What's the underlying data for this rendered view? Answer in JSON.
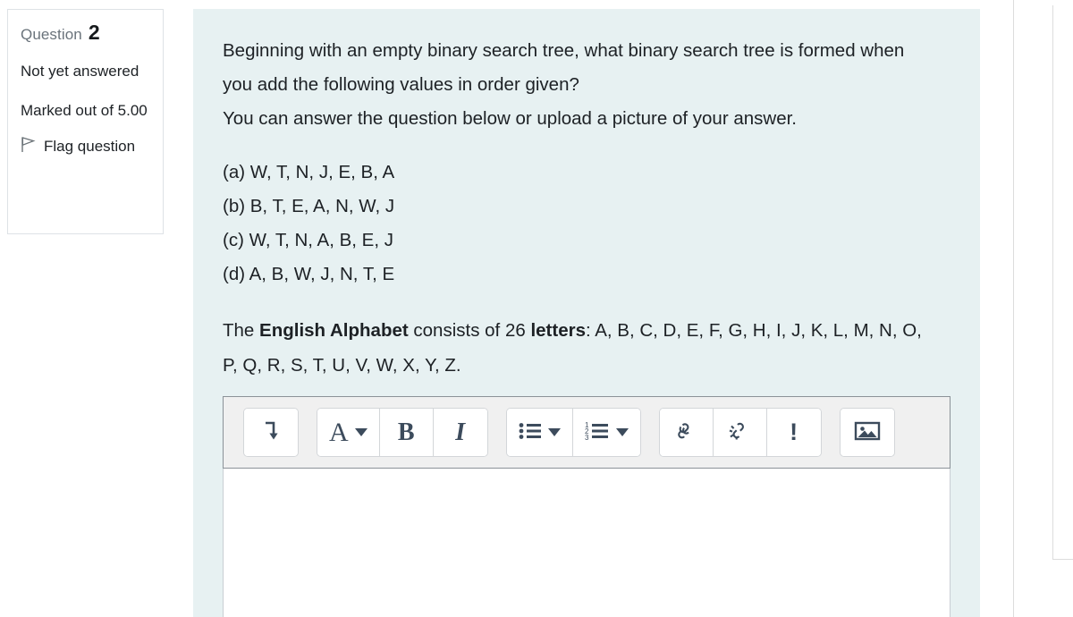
{
  "question_panel": {
    "question_label": "Question",
    "question_number": "2",
    "state": "Not yet answered",
    "marks": "Marked out of 5.00",
    "flag_label": "Flag question",
    "flag_icon": "flag-outline-icon"
  },
  "question": {
    "paragraphs": [
      "Beginning with an empty binary search tree, what binary search tree is formed when you add the following values in order given?",
      "You can answer the question below or upload a picture of your answer."
    ],
    "options": [
      "(a) W, T, N, J, E, B, A",
      "(b) B, T, E, A, N, W, J",
      "(c) W, T, N, A, B, E, J",
      "(d) A, B, W, J, N, T, E"
    ],
    "alphabet_note": {
      "prefix": "The ",
      "bold1": "English Alphabet",
      "middle": " consists of 26 ",
      "bold2": "letters",
      "suffix": ": A, B, C, D, E, F, G, H, I, J, K, L, M, N, O, P, Q, R, S, T, U, V, W, X, Y, Z."
    }
  },
  "editor": {
    "toolbar": {
      "expand": {
        "icon": "arrow-turn-down-icon",
        "label": ""
      },
      "style": {
        "icon": "text-style-icon",
        "label": "A",
        "has_caret": true
      },
      "bold": {
        "icon": "bold-icon",
        "label": "B"
      },
      "italic": {
        "icon": "italic-icon",
        "label": "I"
      },
      "bulleted_list": {
        "icon": "bulleted-list-icon",
        "has_caret": true
      },
      "numbered_list": {
        "icon": "numbered-list-icon",
        "numbers": [
          "1",
          "2",
          "3"
        ],
        "has_caret": true
      },
      "link": {
        "icon": "link-icon"
      },
      "unlink": {
        "icon": "unlink-icon"
      },
      "accessibility": {
        "icon": "exclamation-icon",
        "label": "!"
      },
      "image": {
        "icon": "image-icon"
      }
    },
    "body_value": "",
    "body_placeholder": ""
  },
  "colors": {
    "content_panel_bg": "#e7f1f2",
    "toolbar_bg": "#f0f0f0",
    "toolbar_border": "#8b9298",
    "icon": "#3c4b5c",
    "muted_text": "#6a737b"
  }
}
